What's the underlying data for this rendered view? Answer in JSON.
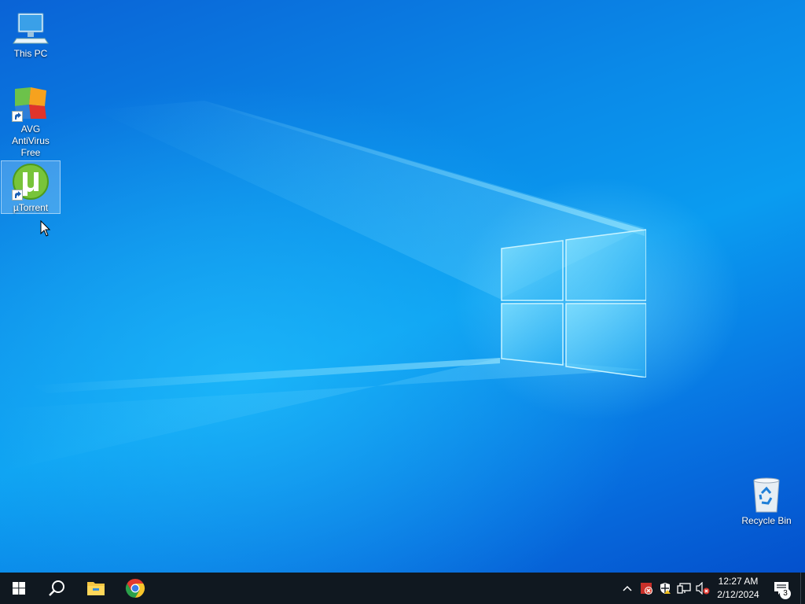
{
  "desktop": {
    "icons": [
      {
        "label": "This PC",
        "icon": "computer-icon"
      },
      {
        "label": "AVG AntiVirus Free",
        "icon": "avg-antivirus-icon",
        "shortcut": true
      },
      {
        "label": "µTorrent",
        "icon": "utorrent-icon",
        "shortcut": true,
        "selected": true
      },
      {
        "label": "Recycle Bin",
        "icon": "recycle-bin-icon"
      }
    ],
    "wallpaper_colors": {
      "deep": "#0450cc",
      "mid": "#0a9cf0",
      "glow": "#7fdcff"
    }
  },
  "taskbar": {
    "background": "#101820",
    "pinned": [
      {
        "name": "Start",
        "icon": "windows-start-icon"
      },
      {
        "name": "Search",
        "icon": "search-icon"
      },
      {
        "name": "File Explorer",
        "icon": "file-explorer-icon"
      },
      {
        "name": "Google Chrome",
        "icon": "chrome-icon"
      }
    ],
    "tray": {
      "icons": [
        "chevron-up-icon",
        "avg-tray-icon",
        "security-shield-icon",
        "network-icon",
        "volume-muted-icon"
      ],
      "time": "12:27 AM",
      "date": "2/12/2024",
      "notification_count": "3"
    }
  }
}
